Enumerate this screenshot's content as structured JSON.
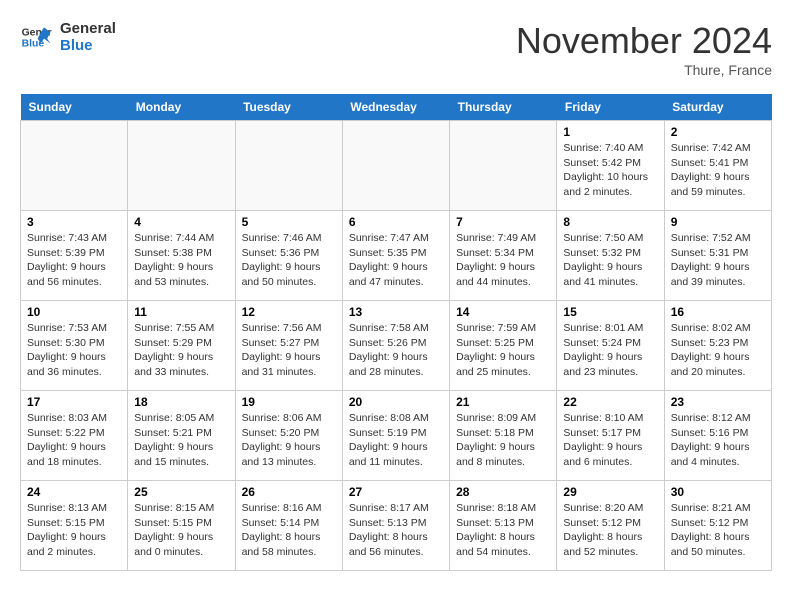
{
  "header": {
    "logo_line1": "General",
    "logo_line2": "Blue",
    "month": "November 2024",
    "location": "Thure, France"
  },
  "days_of_week": [
    "Sunday",
    "Monday",
    "Tuesday",
    "Wednesday",
    "Thursday",
    "Friday",
    "Saturday"
  ],
  "weeks": [
    [
      {
        "day": "",
        "info": ""
      },
      {
        "day": "",
        "info": ""
      },
      {
        "day": "",
        "info": ""
      },
      {
        "day": "",
        "info": ""
      },
      {
        "day": "",
        "info": ""
      },
      {
        "day": "1",
        "info": "Sunrise: 7:40 AM\nSunset: 5:42 PM\nDaylight: 10 hours and 2 minutes."
      },
      {
        "day": "2",
        "info": "Sunrise: 7:42 AM\nSunset: 5:41 PM\nDaylight: 9 hours and 59 minutes."
      }
    ],
    [
      {
        "day": "3",
        "info": "Sunrise: 7:43 AM\nSunset: 5:39 PM\nDaylight: 9 hours and 56 minutes."
      },
      {
        "day": "4",
        "info": "Sunrise: 7:44 AM\nSunset: 5:38 PM\nDaylight: 9 hours and 53 minutes."
      },
      {
        "day": "5",
        "info": "Sunrise: 7:46 AM\nSunset: 5:36 PM\nDaylight: 9 hours and 50 minutes."
      },
      {
        "day": "6",
        "info": "Sunrise: 7:47 AM\nSunset: 5:35 PM\nDaylight: 9 hours and 47 minutes."
      },
      {
        "day": "7",
        "info": "Sunrise: 7:49 AM\nSunset: 5:34 PM\nDaylight: 9 hours and 44 minutes."
      },
      {
        "day": "8",
        "info": "Sunrise: 7:50 AM\nSunset: 5:32 PM\nDaylight: 9 hours and 41 minutes."
      },
      {
        "day": "9",
        "info": "Sunrise: 7:52 AM\nSunset: 5:31 PM\nDaylight: 9 hours and 39 minutes."
      }
    ],
    [
      {
        "day": "10",
        "info": "Sunrise: 7:53 AM\nSunset: 5:30 PM\nDaylight: 9 hours and 36 minutes."
      },
      {
        "day": "11",
        "info": "Sunrise: 7:55 AM\nSunset: 5:29 PM\nDaylight: 9 hours and 33 minutes."
      },
      {
        "day": "12",
        "info": "Sunrise: 7:56 AM\nSunset: 5:27 PM\nDaylight: 9 hours and 31 minutes."
      },
      {
        "day": "13",
        "info": "Sunrise: 7:58 AM\nSunset: 5:26 PM\nDaylight: 9 hours and 28 minutes."
      },
      {
        "day": "14",
        "info": "Sunrise: 7:59 AM\nSunset: 5:25 PM\nDaylight: 9 hours and 25 minutes."
      },
      {
        "day": "15",
        "info": "Sunrise: 8:01 AM\nSunset: 5:24 PM\nDaylight: 9 hours and 23 minutes."
      },
      {
        "day": "16",
        "info": "Sunrise: 8:02 AM\nSunset: 5:23 PM\nDaylight: 9 hours and 20 minutes."
      }
    ],
    [
      {
        "day": "17",
        "info": "Sunrise: 8:03 AM\nSunset: 5:22 PM\nDaylight: 9 hours and 18 minutes."
      },
      {
        "day": "18",
        "info": "Sunrise: 8:05 AM\nSunset: 5:21 PM\nDaylight: 9 hours and 15 minutes."
      },
      {
        "day": "19",
        "info": "Sunrise: 8:06 AM\nSunset: 5:20 PM\nDaylight: 9 hours and 13 minutes."
      },
      {
        "day": "20",
        "info": "Sunrise: 8:08 AM\nSunset: 5:19 PM\nDaylight: 9 hours and 11 minutes."
      },
      {
        "day": "21",
        "info": "Sunrise: 8:09 AM\nSunset: 5:18 PM\nDaylight: 9 hours and 8 minutes."
      },
      {
        "day": "22",
        "info": "Sunrise: 8:10 AM\nSunset: 5:17 PM\nDaylight: 9 hours and 6 minutes."
      },
      {
        "day": "23",
        "info": "Sunrise: 8:12 AM\nSunset: 5:16 PM\nDaylight: 9 hours and 4 minutes."
      }
    ],
    [
      {
        "day": "24",
        "info": "Sunrise: 8:13 AM\nSunset: 5:15 PM\nDaylight: 9 hours and 2 minutes."
      },
      {
        "day": "25",
        "info": "Sunrise: 8:15 AM\nSunset: 5:15 PM\nDaylight: 9 hours and 0 minutes."
      },
      {
        "day": "26",
        "info": "Sunrise: 8:16 AM\nSunset: 5:14 PM\nDaylight: 8 hours and 58 minutes."
      },
      {
        "day": "27",
        "info": "Sunrise: 8:17 AM\nSunset: 5:13 PM\nDaylight: 8 hours and 56 minutes."
      },
      {
        "day": "28",
        "info": "Sunrise: 8:18 AM\nSunset: 5:13 PM\nDaylight: 8 hours and 54 minutes."
      },
      {
        "day": "29",
        "info": "Sunrise: 8:20 AM\nSunset: 5:12 PM\nDaylight: 8 hours and 52 minutes."
      },
      {
        "day": "30",
        "info": "Sunrise: 8:21 AM\nSunset: 5:12 PM\nDaylight: 8 hours and 50 minutes."
      }
    ]
  ]
}
